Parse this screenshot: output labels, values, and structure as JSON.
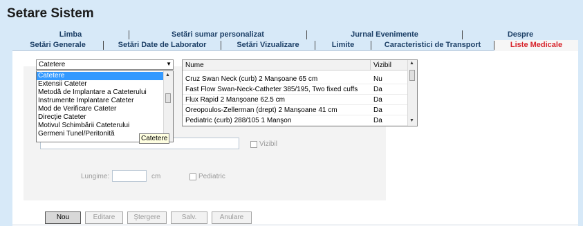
{
  "window": {
    "title": "Setare Sistem"
  },
  "tabs_row1": [
    "Limba",
    "Setări sumar personalizat",
    "Jurnal Evenimente",
    "Despre"
  ],
  "tabs_row2": [
    "Setări Generale",
    "Setări Date de Laborator",
    "Setări Vizualizare",
    "Limite",
    "Caracteristici de Transport",
    "Liste Medicale"
  ],
  "active_tab": "Liste Medicale",
  "colors": {
    "background": "#d7e9f8",
    "active_tab_text": "#d8232a",
    "tab_text": "#1c3f66",
    "selection": "#3399ff"
  },
  "category_select": {
    "selected": "Catetere",
    "options": [
      "Catetere",
      "Extensii Cateter",
      "Metodă de Implantare a Cateterului",
      "Instrumente Implantare Cateter",
      "Mod de Verificare Cateter",
      "Direcţie Cateter",
      "Motivul Schimbării Cateterului",
      "Germeni Tunel/Peritonită"
    ],
    "tooltip": "Catetere"
  },
  "table": {
    "columns": [
      "Nume",
      "Vizibil"
    ],
    "rows": [
      {
        "name": "Cruz Swan Neck (curb) 2 Manşoane 65 cm",
        "visible": "Nu"
      },
      {
        "name": "Fast Flow Swan-Neck-Catheter 385/195, Two fixed cuffs",
        "visible": "Da"
      },
      {
        "name": "Flux Rapid 2 Manşoane 62.5 cm",
        "visible": "Da"
      },
      {
        "name": "Oreopoulos-Zellerman (drept) 2 Manşoane 41 cm",
        "visible": "Da"
      },
      {
        "name": "Pediatric (curb) 288/105 1 Manşon",
        "visible": "Da"
      }
    ]
  },
  "form": {
    "name_value": "",
    "visible_label": "Vizibil",
    "length_label": "Lungime:",
    "length_value": "",
    "length_unit": "cm",
    "pediatric_label": "Pediatric"
  },
  "buttons": {
    "new": "Nou",
    "edit": "Editare",
    "delete": "Ştergere",
    "save": "Salv.",
    "cancel": "Anulare"
  }
}
